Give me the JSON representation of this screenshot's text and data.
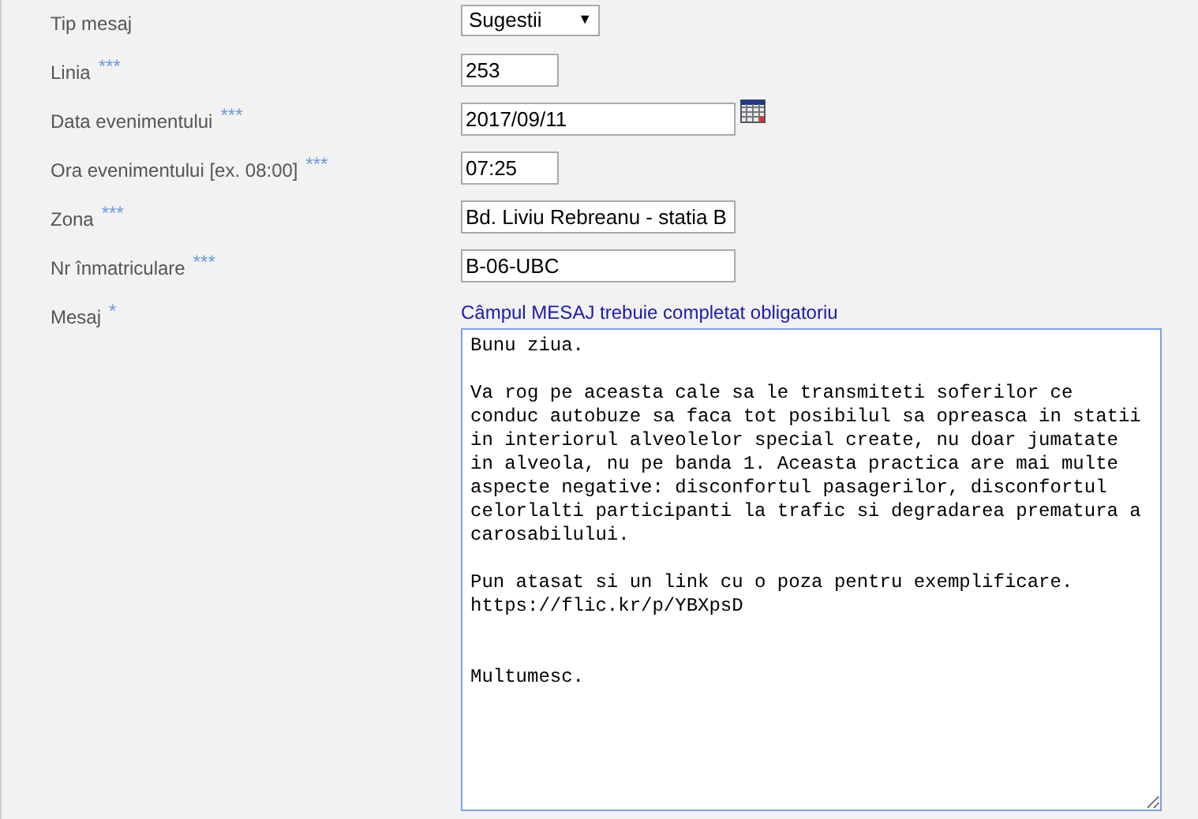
{
  "fields": [
    {
      "label": "Tip mesaj",
      "kind": "select",
      "value": "Sugestii",
      "arrow": "▼"
    },
    {
      "label": "Linia",
      "required_mark": "***",
      "kind": "short",
      "value": "253"
    },
    {
      "label": "Data evenimentului",
      "required_mark": "***",
      "kind": "date",
      "value": "2017/09/11"
    },
    {
      "label": "Ora evenimentului [ex. 08:00]",
      "required_mark": "***",
      "kind": "short",
      "value": "07:25"
    },
    {
      "label": "Zona",
      "required_mark": "***",
      "kind": "text",
      "value": "Bd. Liviu Rebreanu - statia B"
    },
    {
      "label": "Nr înmatriculare",
      "required_mark": "***",
      "kind": "text",
      "value": "B-06-UBC"
    }
  ],
  "message": {
    "label": "Mesaj",
    "required_mark": "*",
    "hint": "Câmpul MESAJ trebuie completat obligatoriu",
    "value": "Bunu ziua.\n\nVa rog pe aceasta cale sa le transmiteti soferilor ce\nconduc autobuze sa faca tot posibilul sa opreasca in statii\nin interiorul alveolelor special create, nu doar jumatate\nin alveola, nu pe banda 1. Aceasta practica are mai multe\naspecte negative: disconfortul pasagerilor, disconfortul\ncelorlalti participanti la trafic si degradarea prematura a\ncarosabilului.\n\nPun atasat si un link cu o poza pentru exemplificare.\nhttps://flic.kr/p/YBXpsD\n\n\nMultumesc."
  }
}
